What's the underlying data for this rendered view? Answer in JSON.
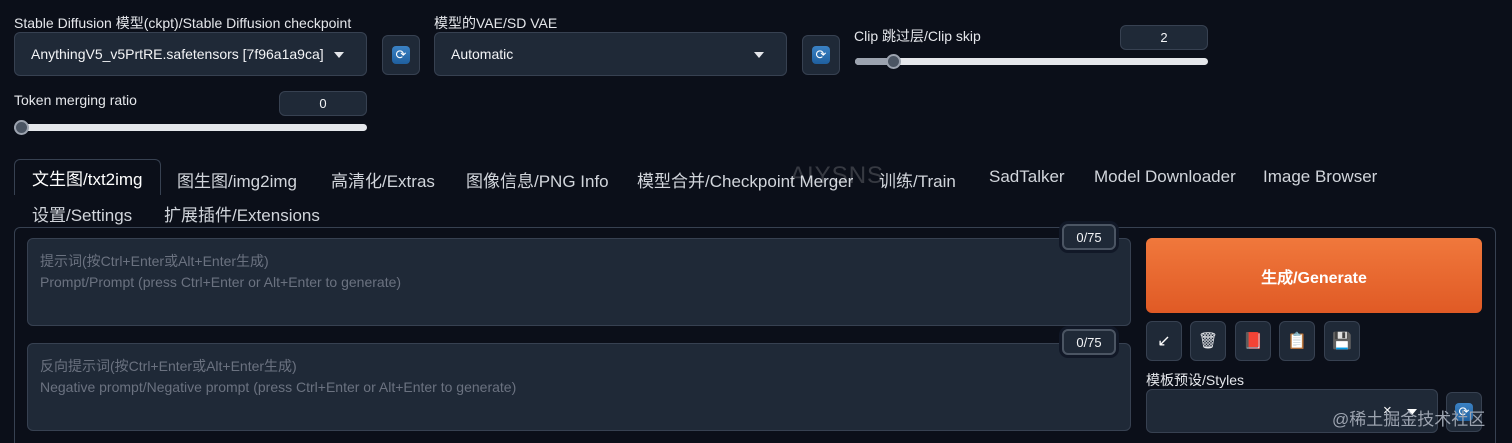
{
  "checkpoint": {
    "label": "Stable Diffusion 模型(ckpt)/Stable Diffusion checkpoint",
    "value": "AnythingV5_v5PrtRE.safetensors [7f96a1a9ca]",
    "refresh_icon": "refresh-icon"
  },
  "vae": {
    "label": "模型的VAE/SD VAE",
    "value": "Automatic",
    "refresh_icon": "refresh-icon"
  },
  "clip_skip": {
    "label": "Clip 跳过层/Clip skip",
    "value": "2",
    "fraction": 0.08
  },
  "token_merging": {
    "label": "Token merging ratio",
    "value": "0",
    "fraction": 0.0
  },
  "tabs": [
    {
      "label": "文生图/txt2img",
      "active": true
    },
    {
      "label": "图生图/img2img"
    },
    {
      "label": "高清化/Extras"
    },
    {
      "label": "图像信息/PNG Info"
    },
    {
      "label": "模型合并/Checkpoint Merger"
    },
    {
      "label": "训练/Train"
    },
    {
      "label": "SadTalker"
    },
    {
      "label": "Model Downloader"
    },
    {
      "label": "Image Browser"
    },
    {
      "label": "设置/Settings"
    },
    {
      "label": "扩展插件/Extensions"
    }
  ],
  "watermark": "AIYSNS",
  "prompt": {
    "counter": "0/75",
    "placeholder_line1": "提示词(按Ctrl+Enter或Alt+Enter生成)",
    "placeholder_line2": "Prompt/Prompt (press Ctrl+Enter or Alt+Enter to generate)"
  },
  "negative_prompt": {
    "counter": "0/75",
    "placeholder_line1": "反向提示词(按Ctrl+Enter或Alt+Enter生成)",
    "placeholder_line2": "Negative prompt/Negative prompt (press Ctrl+Enter or Alt+Enter to generate)"
  },
  "generate_label": "生成/Generate",
  "tools": {
    "glyphs": [
      "↙",
      "🗑",
      "📕",
      "📋",
      "💾"
    ],
    "icons": [
      "arrow-down-left-icon",
      "trash-icon",
      "book-icon",
      "clipboard-icon",
      "save-icon"
    ]
  },
  "styles": {
    "label": "模板预设/Styles",
    "clear_glyph": "×"
  },
  "footer_mark": "@稀土掘金技术社区",
  "colors": {
    "background": "#0b0f19",
    "panel": "#1f2937",
    "border": "#374151",
    "accent": "#e8662e"
  }
}
